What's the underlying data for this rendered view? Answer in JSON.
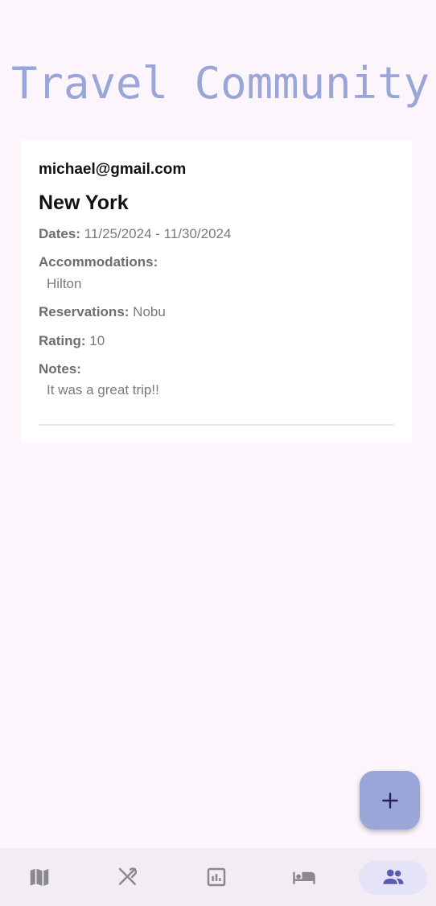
{
  "app": {
    "title": "Travel Community"
  },
  "post": {
    "email": "michael@gmail.com",
    "city": "New York",
    "dates_label": "Dates:",
    "dates_value": "11/25/2024 - 11/30/2024",
    "accommodations_label": "Accommodations:",
    "accommodations_value": "Hilton",
    "reservations_label": "Reservations:",
    "reservations_value": "Nobu",
    "rating_label": "Rating:",
    "rating_value": "10",
    "notes_label": "Notes:",
    "notes_value": "It was a great trip!!"
  },
  "fab": {
    "icon": "plus-icon"
  },
  "bottom_nav": {
    "items": [
      {
        "icon": "map-icon",
        "active": false
      },
      {
        "icon": "restaurant-icon",
        "active": false
      },
      {
        "icon": "bar-chart-icon",
        "active": false
      },
      {
        "icon": "hotel-bed-icon",
        "active": false
      },
      {
        "icon": "community-people-icon",
        "active": true
      }
    ]
  },
  "colors": {
    "background": "#fcf6fc",
    "accent": "#9aa6d8",
    "nav_background": "#f2ecf4",
    "nav_active_pill": "#e4e3f8",
    "icon_inactive": "#8a8a8a",
    "icon_active": "#5a5ab0"
  }
}
